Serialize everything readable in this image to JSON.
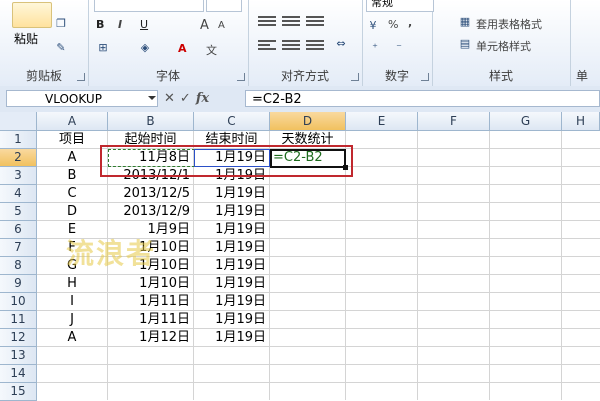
{
  "ribbon": {
    "clipboard": {
      "paste": "粘贴",
      "label": "剪贴板"
    },
    "font": {
      "label": "字体",
      "bold": "B",
      "italic": "I",
      "underline": "U",
      "grow": "A",
      "shrink": "A"
    },
    "alignment": {
      "label": "对齐方式"
    },
    "number": {
      "label": "数字",
      "format_value": "常规",
      "percent": "%",
      "comma": ","
    },
    "styles": {
      "label": "样式",
      "table_format": "套用表格格式",
      "cell_styles": "单元格样式"
    },
    "cells": {
      "label": "单"
    }
  },
  "formula_bar": {
    "name_box": "VLOOKUP",
    "cancel": "✕",
    "enter": "✓",
    "fx": "fx",
    "formula": "=C2-B2"
  },
  "grid": {
    "columns": [
      "A",
      "B",
      "C",
      "D",
      "E",
      "F",
      "G",
      "H"
    ],
    "rows": [
      "1",
      "2",
      "3",
      "4",
      "5",
      "6",
      "7",
      "8",
      "9",
      "10",
      "11",
      "12",
      "13",
      "14",
      "15"
    ],
    "cells": {
      "A1": "项目",
      "B1": "起始时间",
      "C1": "结束时间",
      "D1": "天数统计",
      "A2": "A",
      "B2": "11月8日",
      "C2": "1月19日",
      "D2": "=C2-B2",
      "A3": "B",
      "B3": "2013/12/1",
      "C3": "1月19日",
      "A4": "C",
      "B4": "2013/12/5",
      "C4": "1月19日",
      "A5": "D",
      "B5": "2013/12/9",
      "C5": "1月19日",
      "A6": "E",
      "B6": "1月9日",
      "C6": "1月19日",
      "A7": "F",
      "B7": "1月10日",
      "C7": "1月19日",
      "A8": "G",
      "B8": "1月10日",
      "C8": "1月19日",
      "A9": "H",
      "B9": "1月10日",
      "C9": "1月19日",
      "A10": "I",
      "B10": "1月11日",
      "C10": "1月19日",
      "A11": "J",
      "B11": "1月11日",
      "C11": "1月19日",
      "A12": "A",
      "B12": "1月12日",
      "C12": "1月19日"
    }
  },
  "watermark": "流浪者",
  "colors": {
    "ribbon_bg": "#e4ecf7",
    "header_selected": "#f1c15f",
    "annotation_red": "#c0282e",
    "ref_green": "#2f7d2f",
    "ref_blue": "#2a4fc7"
  }
}
